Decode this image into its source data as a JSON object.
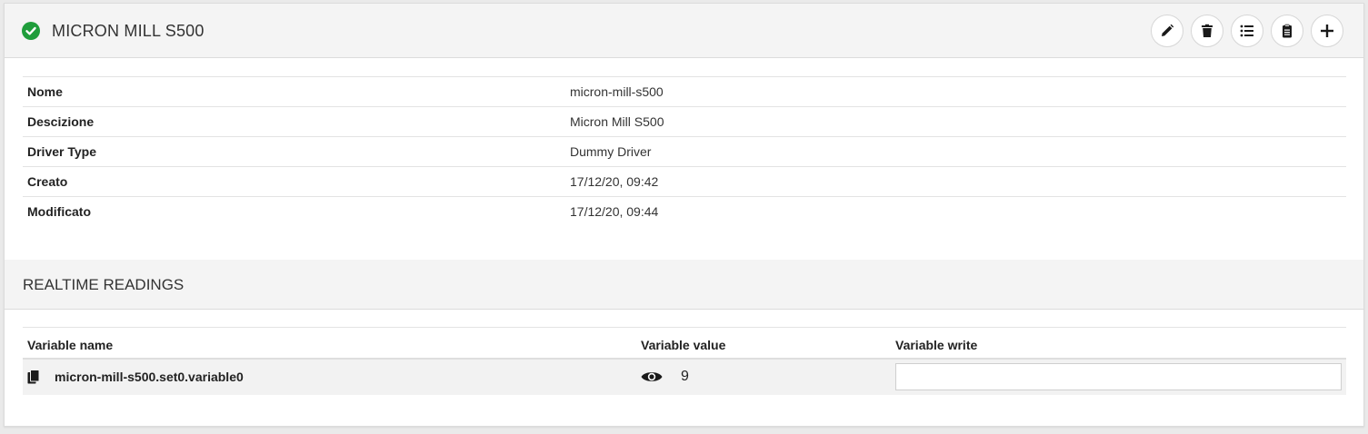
{
  "header": {
    "title": "MICRON MILL S500",
    "status_icon": "check-circle-icon",
    "status_color": "#1f9d3b",
    "toolbar": [
      {
        "icon": "pencil-icon",
        "action": "edit"
      },
      {
        "icon": "trash-icon",
        "action": "delete"
      },
      {
        "icon": "list-icon",
        "action": "list"
      },
      {
        "icon": "clipboard-icon",
        "action": "clipboard"
      },
      {
        "icon": "plus-icon",
        "action": "add"
      }
    ]
  },
  "info": [
    {
      "key": "Nome",
      "value": "micron-mill-s500"
    },
    {
      "key": "Descizione",
      "value": "Micron Mill S500"
    },
    {
      "key": "Driver Type",
      "value": "Dummy Driver"
    },
    {
      "key": "Creato",
      "value": "17/12/20, 09:42"
    },
    {
      "key": "Modificato",
      "value": "17/12/20, 09:44"
    }
  ],
  "realtime": {
    "title": "REALTIME READINGS",
    "columns": [
      "Variable name",
      "Variable value",
      "Variable write"
    ],
    "rows": [
      {
        "name": "micron-mill-s500.set0.variable0",
        "value": "9",
        "write": ""
      }
    ]
  }
}
